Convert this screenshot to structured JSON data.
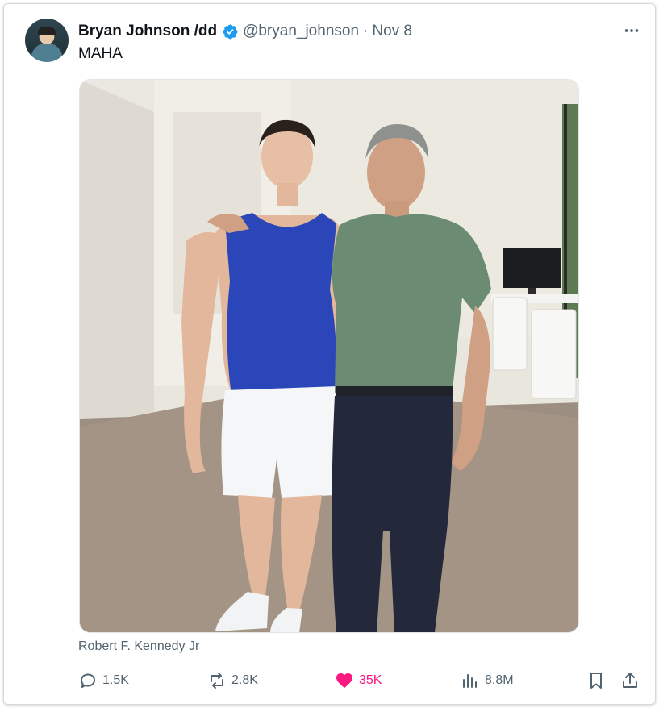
{
  "author": {
    "display_name": "Bryan Johnson /dd",
    "handle": "@bryan_johnson",
    "separator": "·",
    "date": "Nov 8",
    "verified_color": "#1d9bf0"
  },
  "tweet": {
    "text": "MAHA",
    "tagged_person": "Robert F. Kennedy Jr"
  },
  "icons": {
    "more": "more-horizontal-icon",
    "reply": "reply-icon",
    "retweet": "retweet-icon",
    "like": "heart-icon",
    "views": "views-icon",
    "bookmark": "bookmark-icon",
    "share": "share-icon"
  },
  "actions": {
    "replies": "1.5K",
    "retweets": "2.8K",
    "likes": "35K",
    "views": "8.8M"
  },
  "colors": {
    "like": "#f91880",
    "muted": "#536471",
    "text": "#0f1419"
  }
}
